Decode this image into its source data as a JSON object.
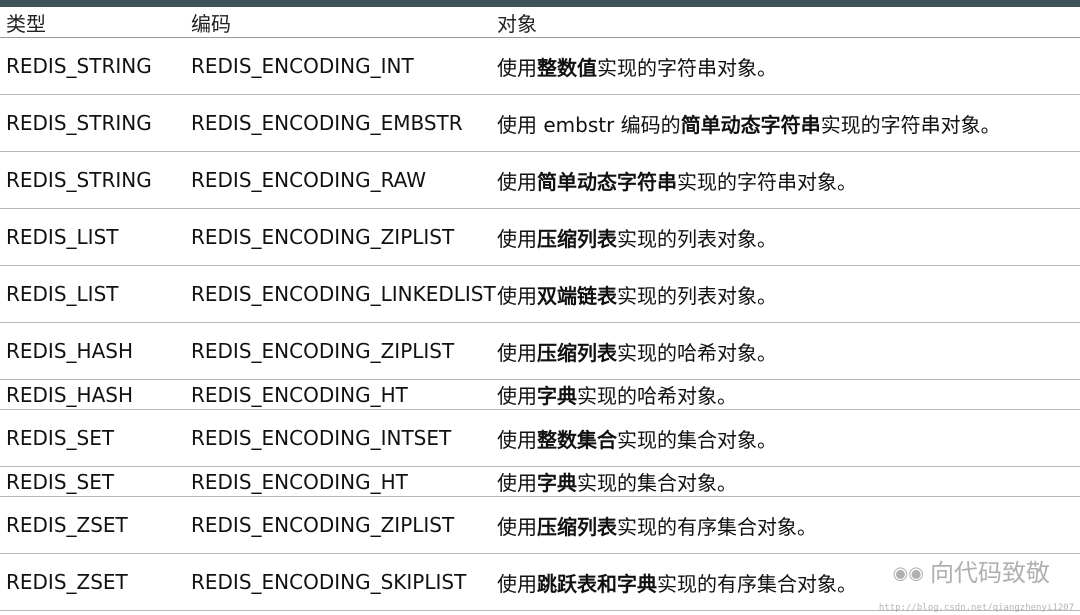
{
  "table": {
    "headers": [
      "类型",
      "编码",
      "对象"
    ],
    "rows": [
      {
        "type": "REDIS_STRING",
        "encoding": "REDIS_ENCODING_INT",
        "desc": [
          {
            "t": "使用",
            "b": false
          },
          {
            "t": "整数值",
            "b": true
          },
          {
            "t": "实现的字符串对象。",
            "b": false
          }
        ]
      },
      {
        "type": "REDIS_STRING",
        "encoding": "REDIS_ENCODING_EMBSTR",
        "desc": [
          {
            "t": "使用 embstr 编码的",
            "b": false
          },
          {
            "t": "简单动态字符串",
            "b": true
          },
          {
            "t": "实现的字符串对象。",
            "b": false
          }
        ]
      },
      {
        "type": "REDIS_STRING",
        "encoding": "REDIS_ENCODING_RAW",
        "desc": [
          {
            "t": "使用",
            "b": false
          },
          {
            "t": "简单动态字符串",
            "b": true
          },
          {
            "t": "实现的字符串对象。",
            "b": false
          }
        ]
      },
      {
        "type": "REDIS_LIST",
        "encoding": "REDIS_ENCODING_ZIPLIST",
        "desc": [
          {
            "t": "使用",
            "b": false
          },
          {
            "t": "压缩列表",
            "b": true
          },
          {
            "t": "实现的列表对象。",
            "b": false
          }
        ]
      },
      {
        "type": "REDIS_LIST",
        "encoding": "REDIS_ENCODING_LINKEDLIST",
        "desc": [
          {
            "t": "使用",
            "b": false
          },
          {
            "t": "双端链表",
            "b": true
          },
          {
            "t": "实现的列表对象。",
            "b": false
          }
        ]
      },
      {
        "type": "REDIS_HASH",
        "encoding": "REDIS_ENCODING_ZIPLIST",
        "desc": [
          {
            "t": "使用",
            "b": false
          },
          {
            "t": "压缩列表",
            "b": true
          },
          {
            "t": "实现的哈希对象。",
            "b": false
          }
        ]
      },
      {
        "type": "REDIS_HASH",
        "encoding": "REDIS_ENCODING_HT",
        "desc": [
          {
            "t": "使用",
            "b": false
          },
          {
            "t": "字典",
            "b": true
          },
          {
            "t": "实现的哈希对象。",
            "b": false
          }
        ]
      },
      {
        "type": "REDIS_SET",
        "encoding": "REDIS_ENCODING_INTSET",
        "desc": [
          {
            "t": "使用",
            "b": false
          },
          {
            "t": "整数集合",
            "b": true
          },
          {
            "t": "实现的集合对象。",
            "b": false
          }
        ]
      },
      {
        "type": "REDIS_SET",
        "encoding": "REDIS_ENCODING_HT",
        "desc": [
          {
            "t": "使用",
            "b": false
          },
          {
            "t": "字典",
            "b": true
          },
          {
            "t": "实现的集合对象。",
            "b": false
          }
        ]
      },
      {
        "type": "REDIS_ZSET",
        "encoding": "REDIS_ENCODING_ZIPLIST",
        "desc": [
          {
            "t": "使用",
            "b": false
          },
          {
            "t": "压缩列表",
            "b": true
          },
          {
            "t": "实现的有序集合对象。",
            "b": false
          }
        ]
      },
      {
        "type": "REDIS_ZSET",
        "encoding": "REDIS_ENCODING_SKIPLIST",
        "desc": [
          {
            "t": "使用",
            "b": false
          },
          {
            "t": "跳跃表和字典",
            "b": true
          },
          {
            "t": "实现的有序集合对象。",
            "b": false
          }
        ]
      }
    ]
  },
  "watermark": {
    "icon": "wechat-icon",
    "text": "向代码致敬",
    "url": "http://blog.csdn.net/qiangzhenyi1207"
  },
  "colors": {
    "top_bar": "#3d5359",
    "row_border": "#b8b8b8",
    "text": "#111111"
  }
}
